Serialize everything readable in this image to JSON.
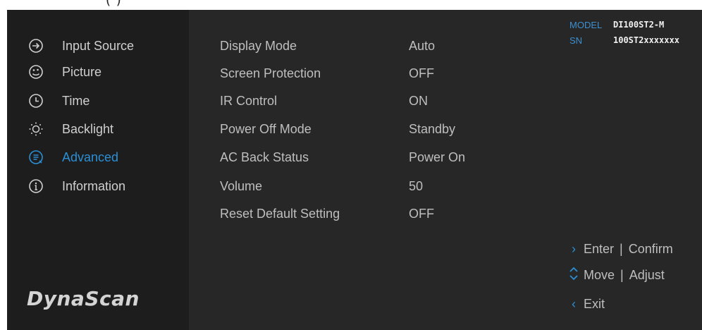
{
  "top_strip_text": "(     )    ",
  "sidebar": {
    "items": [
      {
        "label": "Input Source",
        "icon": "arrow-circle-icon",
        "active": false
      },
      {
        "label": "Picture",
        "icon": "palette-icon",
        "active": false
      },
      {
        "label": "Time",
        "icon": "clock-icon",
        "active": false
      },
      {
        "label": "Backlight",
        "icon": "sun-icon",
        "active": false
      },
      {
        "label": "Advanced",
        "icon": "advanced-icon",
        "active": true
      },
      {
        "label": "Information",
        "icon": "info-icon",
        "active": false
      }
    ],
    "logo": "DynaScan"
  },
  "settings": [
    {
      "label": "Display Mode",
      "value": "Auto"
    },
    {
      "label": "Screen Protection",
      "value": "OFF"
    },
    {
      "label": "IR Control",
      "value": "ON"
    },
    {
      "label": "Power Off Mode",
      "value": "Standby"
    },
    {
      "label": "AC Back Status",
      "value": "Power On"
    },
    {
      "label": "Volume",
      "value": "50"
    },
    {
      "label": "Reset Default Setting",
      "value": "OFF"
    }
  ],
  "device": {
    "model_key": "MODEL",
    "model_value": "DI100ST2-M",
    "sn_key": "SN",
    "sn_value": "100ST2xxxxxxx"
  },
  "hints": [
    {
      "key": ">",
      "action": "Enter",
      "alt": "Confirm"
    },
    {
      "key": "^v",
      "action": "Move",
      "alt": "Adjust"
    },
    {
      "key": "<",
      "action": "Exit",
      "alt": ""
    }
  ],
  "colors": {
    "accent": "#2b8fd6",
    "background": "#272727",
    "sidebar": "#1d1d1d",
    "text": "#bfbfbf"
  }
}
